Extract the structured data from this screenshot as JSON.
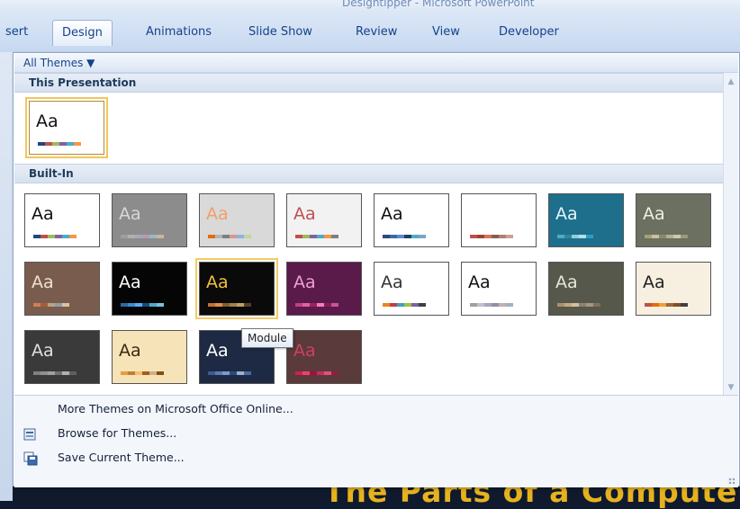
{
  "window": {
    "title": "Designtipper - Microsoft PowerPoint"
  },
  "tabs": [
    {
      "label": "sert",
      "active": false
    },
    {
      "label": "Design",
      "active": true
    },
    {
      "label": "Animations",
      "active": false
    },
    {
      "label": "Slide Show",
      "active": false
    },
    {
      "label": "Review",
      "active": false
    },
    {
      "label": "View",
      "active": false
    },
    {
      "label": "Developer",
      "active": false
    }
  ],
  "gallery": {
    "filter_label": "All Themes ▼",
    "sections": {
      "this_presentation": "This Presentation",
      "built_in": "Built-In"
    },
    "current_theme": {
      "text": "Aa",
      "bg": "#ffffff",
      "fg": "#111111",
      "swatches": [
        "#1f497d",
        "#c0504d",
        "#9bbb59",
        "#8064a2",
        "#4bacc6",
        "#f79646"
      ]
    },
    "themes": [
      {
        "text": "Aa",
        "bg": "#ffffff",
        "fg": "#111111",
        "swatches": [
          "#1f497d",
          "#c0504d",
          "#9bbb59",
          "#8064a2",
          "#4bacc6",
          "#f79646"
        ]
      },
      {
        "text": "Aa",
        "bg": "#8c8c8c",
        "fg": "#d8d8d8",
        "swatches": [
          "#9e9e9e",
          "#b0b0b0",
          "#a6a6c0",
          "#b89ab5",
          "#9ab8c8",
          "#c8b89a"
        ]
      },
      {
        "text": "Aa",
        "bg": "#d9d9d9",
        "fg": "#f0a06a",
        "swatches": [
          "#e46c0a",
          "#b2b2b2",
          "#7f7f7f",
          "#d99694",
          "#8db3e2",
          "#c3d69b"
        ]
      },
      {
        "text": "Aa",
        "bg": "#f2f2f2",
        "fg": "#c0504d",
        "swatches": [
          "#c0504d",
          "#9bbb59",
          "#8064a2",
          "#4bacc6",
          "#f79646",
          "#7f7f7f"
        ]
      },
      {
        "text": "Aa",
        "bg": "#ffffff",
        "fg": "#111111",
        "swatches": [
          "#2c4a7a",
          "#3c6aa0",
          "#5a8ac8",
          "#1f3e66",
          "#4bacc6",
          "#7fa0c8"
        ]
      },
      {
        "text": "Aa",
        "bg": "#ffffff",
        "fg": "#ffffff",
        "swatches": [
          "#c0504d",
          "#a04030",
          "#e07050",
          "#806060",
          "#b08070",
          "#d0a090"
        ]
      },
      {
        "text": "Aa",
        "bg": "#1d6f8c",
        "fg": "#e8f4f8",
        "swatches": [
          "#4bacc6",
          "#31859c",
          "#92cddc",
          "#b6dde8",
          "#2b9fbf",
          "#1f6f88"
        ]
      },
      {
        "text": "Aa",
        "bg": "#6b7060",
        "fg": "#f0f0e0",
        "swatches": [
          "#a6a07a",
          "#c8c0a0",
          "#8a8a6a",
          "#b6b08a",
          "#d0c8a8",
          "#9a9a7a"
        ]
      },
      {
        "text": "Aa",
        "bg": "#7a5c4e",
        "fg": "#f0e0d0",
        "swatches": [
          "#d08050",
          "#a06040",
          "#c0a080",
          "#8aa0b0",
          "#e0c0a0",
          "#706050"
        ]
      },
      {
        "text": "Aa",
        "bg": "#050505",
        "fg": "#ffffff",
        "swatches": [
          "#2a6aa0",
          "#3a8ad0",
          "#5aaaf0",
          "#1a4a80",
          "#4bacc6",
          "#7ac0e0"
        ]
      },
      {
        "text": "Aa",
        "bg": "#0a0a0a",
        "fg": "#f0c040",
        "swatches": [
          "#c07030",
          "#e09040",
          "#806030",
          "#a08050",
          "#c0a060",
          "#504030"
        ]
      },
      {
        "text": "Aa",
        "bg": "#5a1a4a",
        "fg": "#f0a0d0",
        "swatches": [
          "#c04080",
          "#e060a0",
          "#a02060",
          "#f080c0",
          "#802050",
          "#d050a0"
        ]
      },
      {
        "text": "Aa",
        "bg": "#ffffff",
        "fg": "#333333",
        "swatches": [
          "#f08020",
          "#c04040",
          "#40a0c0",
          "#a0c040",
          "#8060a0",
          "#404040"
        ]
      },
      {
        "text": "Aa",
        "bg": "#ffffff",
        "fg": "#111111",
        "swatches": [
          "#a0a0a0",
          "#c0c0d0",
          "#b0a0c0",
          "#9090a0",
          "#c0b0b0",
          "#a0b0c0"
        ]
      },
      {
        "text": "Aa",
        "bg": "#55584a",
        "fg": "#e8e8d8",
        "swatches": [
          "#b0906a",
          "#c8a880",
          "#d0c0a0",
          "#908070",
          "#a09880",
          "#807060"
        ]
      },
      {
        "text": "Aa",
        "bg": "#f7efe0",
        "fg": "#222222",
        "swatches": [
          "#c0504d",
          "#e46c0a",
          "#f0a030",
          "#9a6a3a",
          "#805020",
          "#404040"
        ]
      },
      {
        "text": "Aa",
        "bg": "#3a3a3a",
        "fg": "#e0e0e0",
        "swatches": [
          "#808080",
          "#909090",
          "#a0a0a0",
          "#707070",
          "#b0b0b0",
          "#606060"
        ]
      },
      {
        "text": "Aa",
        "bg": "#f6e3b8",
        "fg": "#3a2a10",
        "swatches": [
          "#e0a040",
          "#c08030",
          "#f0c070",
          "#a06020",
          "#d0b080",
          "#805010"
        ]
      },
      {
        "text": "Aa",
        "bg": "#1e2a44",
        "fg": "#ffffff",
        "swatches": [
          "#3a5a90",
          "#5a7ab0",
          "#7a9ad0",
          "#2a4a80",
          "#9ab0d0",
          "#4a6aa0"
        ]
      },
      {
        "text": "Aa",
        "bg": "#5a3a3a",
        "fg": "#d04060",
        "swatches": [
          "#d02050",
          "#f04070",
          "#a01040",
          "#c03060",
          "#e05080",
          "#902040"
        ]
      }
    ],
    "tooltip": "Module",
    "menu": [
      {
        "label": "More Themes on Microsoft Office Online...",
        "icon": "blank"
      },
      {
        "label": "Browse for Themes...",
        "icon": "folder-icon"
      },
      {
        "label": "Save Current Theme...",
        "icon": "save-icon"
      }
    ]
  },
  "slide": {
    "title": "The Parts of a Computer"
  }
}
